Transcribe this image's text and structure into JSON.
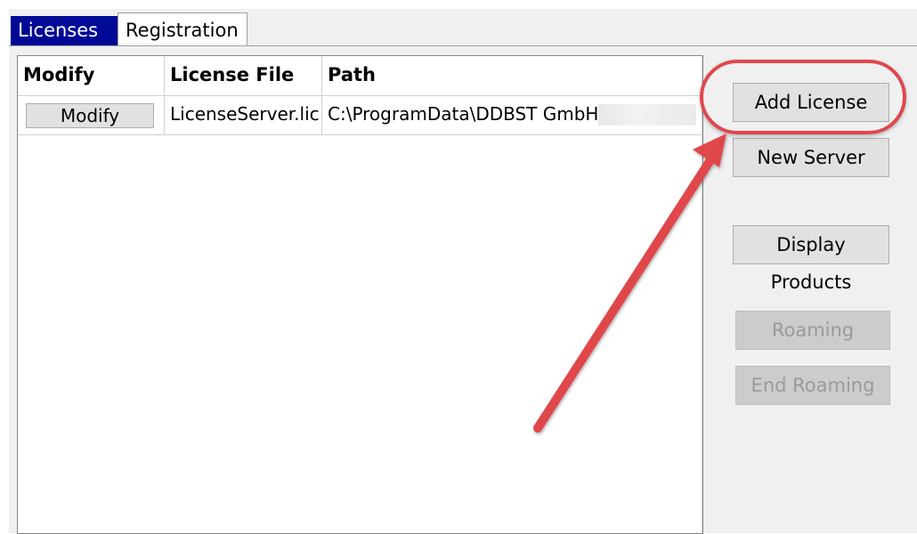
{
  "tabs": [
    {
      "label": "Licenses"
    },
    {
      "label": "Registration"
    }
  ],
  "grid": {
    "columns": [
      "Modify",
      "License File",
      "Path"
    ],
    "rows": [
      {
        "modify_label": "Modify",
        "license_file": "LicenseServer.lic",
        "path": "C:\\ProgramData\\DDBST GmbH\\"
      }
    ]
  },
  "buttons": {
    "add_license": "Add License",
    "new_server": "New Server",
    "display_products": "Display Products",
    "roaming": "Roaming",
    "end_roaming": "End Roaming"
  },
  "colors": {
    "active_tab": "#000a96",
    "annotation": "#e0474c"
  }
}
